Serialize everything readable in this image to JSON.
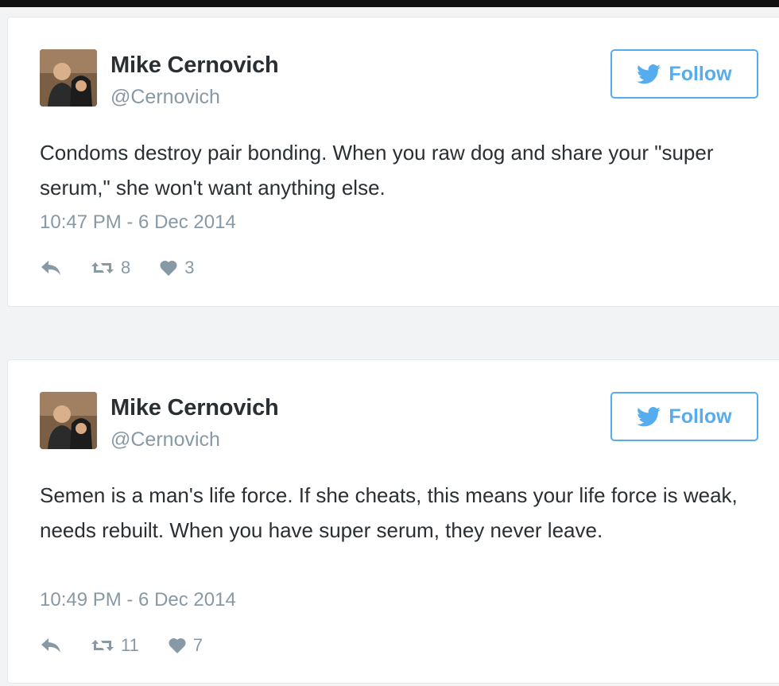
{
  "colors": {
    "accent": "#55acee",
    "text": "#292f33",
    "muted": "#8899a6"
  },
  "tweets": [
    {
      "author_name": "Mike Cernovich",
      "author_handle": "@Cernovich",
      "follow_label": "Follow",
      "text": "Condoms destroy pair bonding. When you raw dog and share your \"super serum,\" she won't want anything else.",
      "timestamp": "10:47 PM - 6 Dec 2014",
      "retweets": "8",
      "likes": "3",
      "icons": [
        "reply-icon",
        "retweet-icon",
        "heart-icon",
        "twitter-bird-icon"
      ]
    },
    {
      "author_name": "Mike Cernovich",
      "author_handle": "@Cernovich",
      "follow_label": "Follow",
      "text": "Semen is a man's life force. If she cheats, this means your life force is weak, needs rebuilt. When you have super serum, they never leave.",
      "timestamp": "10:49 PM - 6 Dec 2014",
      "retweets": "11",
      "likes": "7",
      "icons": [
        "reply-icon",
        "retweet-icon",
        "heart-icon",
        "twitter-bird-icon"
      ]
    }
  ]
}
